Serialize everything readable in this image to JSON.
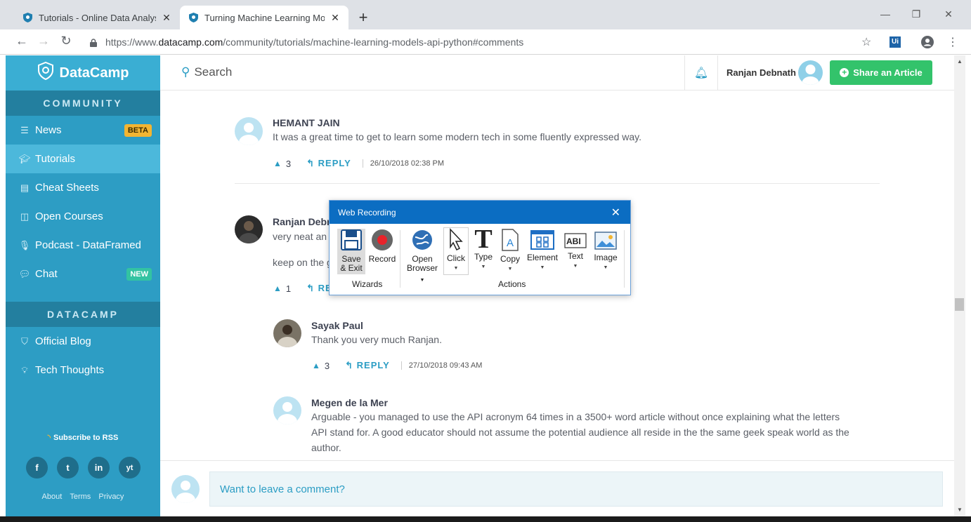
{
  "browser": {
    "tabs": [
      {
        "title": "Tutorials - Online Data Analysis &"
      },
      {
        "title": "Turning Machine Learning Mode"
      }
    ],
    "url_scheme": "https://www.",
    "url_domain": "datacamp.com",
    "url_path": "/community/tutorials/machine-learning-models-api-python#comments"
  },
  "sidebar": {
    "brand": "DataCamp",
    "community_heading": "COMMUNITY",
    "items": [
      {
        "label": "News",
        "badge": "BETA",
        "icon": "list-icon"
      },
      {
        "label": "Tutorials",
        "icon": "graduation-cap-icon",
        "active": true
      },
      {
        "label": "Cheat Sheets",
        "icon": "file-icon"
      },
      {
        "label": "Open Courses",
        "icon": "columns-icon"
      },
      {
        "label": "Podcast - DataFramed",
        "icon": "microphone-icon"
      },
      {
        "label": "Chat",
        "badge": "NEW",
        "icon": "chat-icon"
      }
    ],
    "datacamp_heading": "DATACAMP",
    "datacamp_items": [
      {
        "label": "Official Blog",
        "icon": "shield-icon"
      },
      {
        "label": "Tech Thoughts",
        "icon": "lightbulb-icon"
      }
    ],
    "rss": "Subscribe to RSS",
    "social": [
      "f",
      "t",
      "in",
      "yt"
    ],
    "footer_links": [
      "About",
      "Terms",
      "Privacy"
    ]
  },
  "header": {
    "search_label": "Search",
    "user_name": "Ranjan Debnath",
    "share_label": "Share an Article"
  },
  "comments": [
    {
      "author": "HEMANT JAIN",
      "text": "It was a great time to get to learn some modern tech in some fluently expressed way.",
      "votes": "3",
      "reply": "REPLY",
      "date": "26/10/2018 02:38 PM"
    },
    {
      "author": "Ranjan Debn",
      "text1": "very neat an",
      "text2": "keep on the g",
      "votes": "1",
      "reply": "REP"
    },
    {
      "author": "Sayak Paul",
      "text": "Thank you very much Ranjan.",
      "votes": "3",
      "reply": "REPLY",
      "date": "27/10/2018 09:43 AM"
    },
    {
      "author": "Megen de la Mer",
      "text_lines": [
        "Arguable - you managed to use the API acronym 64 times in a 3500+ word article without once explaining what the letters",
        "API stand for. A good educator should not assume the potential audience all reside in the the same geek speak world as the",
        "author."
      ]
    }
  ],
  "comment_prompt": "Want to leave a comment?",
  "recorder": {
    "title": "Web Recording",
    "tools": {
      "save": [
        "Save",
        "& Exit"
      ],
      "record": "Record",
      "open_browser": [
        "Open",
        "Browser"
      ],
      "click": "Click",
      "type": "Type",
      "copy": "Copy",
      "element": "Element",
      "text": "Text",
      "image": "Image"
    },
    "groups": {
      "wizards": "Wizards",
      "actions": "Actions"
    }
  },
  "colors": {
    "sidebar": "#2d9dc4",
    "accent": "#2b9dc4",
    "share": "#33c36b",
    "recorder_title": "#0b6dc2"
  }
}
